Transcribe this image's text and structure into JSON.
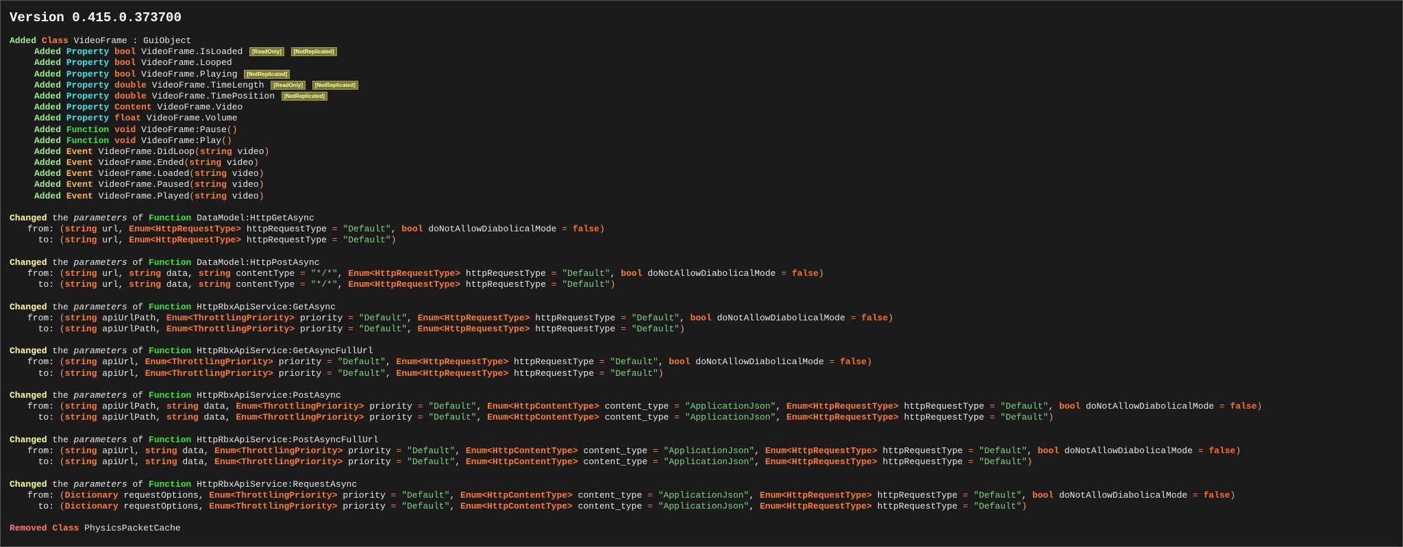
{
  "title": "Version 0.415.0.373700",
  "added_class": {
    "verb": "Added",
    "kind": "Class",
    "name": "VideoFrame",
    "sep": " : ",
    "base": "GuiObject"
  },
  "members": [
    {
      "verb": "Added",
      "kind": "Property",
      "type": "bool",
      "name": "VideoFrame.IsLoaded",
      "tags": [
        "[ReadOnly]",
        "[NotReplicated]"
      ]
    },
    {
      "verb": "Added",
      "kind": "Property",
      "type": "bool",
      "name": "VideoFrame.Looped",
      "tags": []
    },
    {
      "verb": "Added",
      "kind": "Property",
      "type": "bool",
      "name": "VideoFrame.Playing",
      "tags": [
        "[NotReplicated]"
      ]
    },
    {
      "verb": "Added",
      "kind": "Property",
      "type": "double",
      "name": "VideoFrame.TimeLength",
      "tags": [
        "[ReadOnly]",
        "[NotReplicated]"
      ]
    },
    {
      "verb": "Added",
      "kind": "Property",
      "type": "double",
      "name": "VideoFrame.TimePosition",
      "tags": [
        "[NotReplicated]"
      ]
    },
    {
      "verb": "Added",
      "kind": "Property",
      "type": "Content",
      "name": "VideoFrame.Video",
      "tags": []
    },
    {
      "verb": "Added",
      "kind": "Property",
      "type": "float",
      "name": "VideoFrame.Volume",
      "tags": []
    },
    {
      "verb": "Added",
      "kind": "Function",
      "type": "void",
      "name": "VideoFrame:Pause",
      "params": "()"
    },
    {
      "verb": "Added",
      "kind": "Function",
      "type": "void",
      "name": "VideoFrame:Play",
      "params": "()"
    },
    {
      "verb": "Added",
      "kind": "Event",
      "name": "VideoFrame.DidLoop",
      "ptype": "string",
      "pname": "video"
    },
    {
      "verb": "Added",
      "kind": "Event",
      "name": "VideoFrame.Ended",
      "ptype": "string",
      "pname": "video"
    },
    {
      "verb": "Added",
      "kind": "Event",
      "name": "VideoFrame.Loaded",
      "ptype": "string",
      "pname": "video"
    },
    {
      "verb": "Added",
      "kind": "Event",
      "name": "VideoFrame.Paused",
      "ptype": "string",
      "pname": "video"
    },
    {
      "verb": "Added",
      "kind": "Event",
      "name": "VideoFrame.Played",
      "ptype": "string",
      "pname": "video"
    }
  ],
  "words": {
    "the": "the",
    "parameters": "parameters",
    "of": "of",
    "from": "from:",
    "to": "to:"
  },
  "changes": [
    {
      "verb": "Changed",
      "kind": "Function",
      "name": "DataModel:HttpGetAsync",
      "from": [
        [
          "string",
          "url"
        ],
        [
          "Enum<HttpRequestType>",
          "httpRequestType",
          "\"Default\""
        ],
        [
          "bool",
          "doNotAllowDiabolicalMode",
          "false"
        ]
      ],
      "to": [
        [
          "string",
          "url"
        ],
        [
          "Enum<HttpRequestType>",
          "httpRequestType",
          "\"Default\""
        ]
      ]
    },
    {
      "verb": "Changed",
      "kind": "Function",
      "name": "DataModel:HttpPostAsync",
      "from": [
        [
          "string",
          "url"
        ],
        [
          "string",
          "data"
        ],
        [
          "string",
          "contentType",
          "\"*/*\""
        ],
        [
          "Enum<HttpRequestType>",
          "httpRequestType",
          "\"Default\""
        ],
        [
          "bool",
          "doNotAllowDiabolicalMode",
          "false"
        ]
      ],
      "to": [
        [
          "string",
          "url"
        ],
        [
          "string",
          "data"
        ],
        [
          "string",
          "contentType",
          "\"*/*\""
        ],
        [
          "Enum<HttpRequestType>",
          "httpRequestType",
          "\"Default\""
        ]
      ]
    },
    {
      "verb": "Changed",
      "kind": "Function",
      "name": "HttpRbxApiService:GetAsync",
      "from": [
        [
          "string",
          "apiUrlPath"
        ],
        [
          "Enum<ThrottlingPriority>",
          "priority",
          "\"Default\""
        ],
        [
          "Enum<HttpRequestType>",
          "httpRequestType",
          "\"Default\""
        ],
        [
          "bool",
          "doNotAllowDiabolicalMode",
          "false"
        ]
      ],
      "to": [
        [
          "string",
          "apiUrlPath"
        ],
        [
          "Enum<ThrottlingPriority>",
          "priority",
          "\"Default\""
        ],
        [
          "Enum<HttpRequestType>",
          "httpRequestType",
          "\"Default\""
        ]
      ]
    },
    {
      "verb": "Changed",
      "kind": "Function",
      "name": "HttpRbxApiService:GetAsyncFullUrl",
      "from": [
        [
          "string",
          "apiUrl"
        ],
        [
          "Enum<ThrottlingPriority>",
          "priority",
          "\"Default\""
        ],
        [
          "Enum<HttpRequestType>",
          "httpRequestType",
          "\"Default\""
        ],
        [
          "bool",
          "doNotAllowDiabolicalMode",
          "false"
        ]
      ],
      "to": [
        [
          "string",
          "apiUrl"
        ],
        [
          "Enum<ThrottlingPriority>",
          "priority",
          "\"Default\""
        ],
        [
          "Enum<HttpRequestType>",
          "httpRequestType",
          "\"Default\""
        ]
      ]
    },
    {
      "verb": "Changed",
      "kind": "Function",
      "name": "HttpRbxApiService:PostAsync",
      "from": [
        [
          "string",
          "apiUrlPath"
        ],
        [
          "string",
          "data"
        ],
        [
          "Enum<ThrottlingPriority>",
          "priority",
          "\"Default\""
        ],
        [
          "Enum<HttpContentType>",
          "content_type",
          "\"ApplicationJson\""
        ],
        [
          "Enum<HttpRequestType>",
          "httpRequestType",
          "\"Default\""
        ],
        [
          "bool",
          "doNotAllowDiabolicalMode",
          "false"
        ]
      ],
      "to": [
        [
          "string",
          "apiUrlPath"
        ],
        [
          "string",
          "data"
        ],
        [
          "Enum<ThrottlingPriority>",
          "priority",
          "\"Default\""
        ],
        [
          "Enum<HttpContentType>",
          "content_type",
          "\"ApplicationJson\""
        ],
        [
          "Enum<HttpRequestType>",
          "httpRequestType",
          "\"Default\""
        ]
      ]
    },
    {
      "verb": "Changed",
      "kind": "Function",
      "name": "HttpRbxApiService:PostAsyncFullUrl",
      "from": [
        [
          "string",
          "apiUrl"
        ],
        [
          "string",
          "data"
        ],
        [
          "Enum<ThrottlingPriority>",
          "priority",
          "\"Default\""
        ],
        [
          "Enum<HttpContentType>",
          "content_type",
          "\"ApplicationJson\""
        ],
        [
          "Enum<HttpRequestType>",
          "httpRequestType",
          "\"Default\""
        ],
        [
          "bool",
          "doNotAllowDiabolicalMode",
          "false"
        ]
      ],
      "to": [
        [
          "string",
          "apiUrl"
        ],
        [
          "string",
          "data"
        ],
        [
          "Enum<ThrottlingPriority>",
          "priority",
          "\"Default\""
        ],
        [
          "Enum<HttpContentType>",
          "content_type",
          "\"ApplicationJson\""
        ],
        [
          "Enum<HttpRequestType>",
          "httpRequestType",
          "\"Default\""
        ]
      ]
    },
    {
      "verb": "Changed",
      "kind": "Function",
      "name": "HttpRbxApiService:RequestAsync",
      "from": [
        [
          "Dictionary",
          "requestOptions"
        ],
        [
          "Enum<ThrottlingPriority>",
          "priority",
          "\"Default\""
        ],
        [
          "Enum<HttpContentType>",
          "content_type",
          "\"ApplicationJson\""
        ],
        [
          "Enum<HttpRequestType>",
          "httpRequestType",
          "\"Default\""
        ],
        [
          "bool",
          "doNotAllowDiabolicalMode",
          "false"
        ]
      ],
      "to": [
        [
          "Dictionary",
          "requestOptions"
        ],
        [
          "Enum<ThrottlingPriority>",
          "priority",
          "\"Default\""
        ],
        [
          "Enum<HttpContentType>",
          "content_type",
          "\"ApplicationJson\""
        ],
        [
          "Enum<HttpRequestType>",
          "httpRequestType",
          "\"Default\""
        ]
      ]
    }
  ],
  "removed_class": {
    "verb": "Removed",
    "kind": "Class",
    "name": "PhysicsPacketCache"
  }
}
